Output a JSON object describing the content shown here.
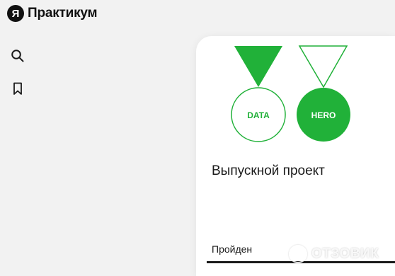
{
  "header": {
    "logo_letter": "Я",
    "logo_text": "Практикум"
  },
  "sidebar": {
    "icons": [
      "search-icon",
      "bookmark-icon"
    ]
  },
  "card": {
    "badge_left_label": "DATA",
    "badge_right_label": "HERO",
    "title": "Выпускной проект",
    "status": "Пройден",
    "progress": 1.0
  },
  "watermark": {
    "text": "ОТЗОВИК"
  },
  "colors": {
    "accent_green": "#21b139",
    "page_background": "#f2f2f2",
    "card_background": "#ffffff",
    "text": "#1a1a1a"
  }
}
